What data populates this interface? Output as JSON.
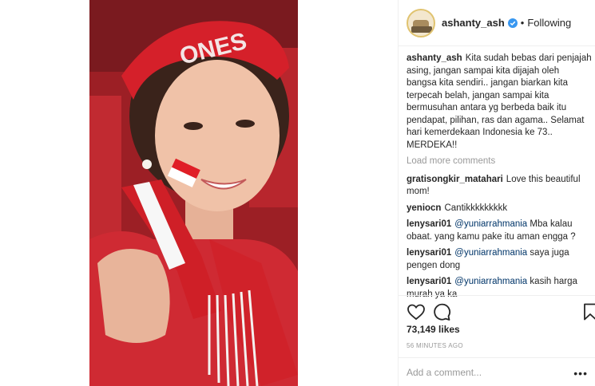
{
  "header": {
    "username": "ashanty_ash",
    "separator": "•",
    "follow_label": "Following"
  },
  "caption": {
    "username": "ashanty_ash",
    "text": "Kita sudah bebas dari penjajah asing, jangan sampai kita dijajah oleh bangsa kita sendiri.. jangan biarkan kita terpecah belah, jangan sampai kita bermusuhan antara yg berbeda baik itu pendapat, pilihan, ras dan agama.. Selamat hari kemerdekaan Indonesia ke 73.. MERDEKA!!"
  },
  "load_more": "Load more comments",
  "comments": [
    {
      "username": "gratisongkir_matahari",
      "mention": "",
      "text": "Love this beautiful mom!"
    },
    {
      "username": "yeniocn",
      "mention": "",
      "text": "Cantikkkkkkkkk"
    },
    {
      "username": "lenysari01",
      "mention": "@yuniarrahmania",
      "text": "Mba kalau obaat. yang kamu pake itu aman engga ?"
    },
    {
      "username": "lenysari01",
      "mention": "@yuniarrahmania",
      "text": "saya juga pengen dong"
    },
    {
      "username": "lenysari01",
      "mention": "@yuniarrahmania",
      "text": "kasih harga murah ya ka"
    }
  ],
  "likes": "73,149 likes",
  "time": "56 MINUTES AGO",
  "add_comment": {
    "placeholder": "Add a comment..."
  },
  "more_label": "•••",
  "photo_text": "ONES",
  "icons": {
    "like": "heart-icon",
    "comment": "comment-icon",
    "save": "bookmark-icon",
    "verified": "verified-badge-icon"
  },
  "colors": {
    "verified_blue": "#3897f0",
    "mention": "#003569",
    "muted": "#999999",
    "photo_red": "#c8242c"
  }
}
